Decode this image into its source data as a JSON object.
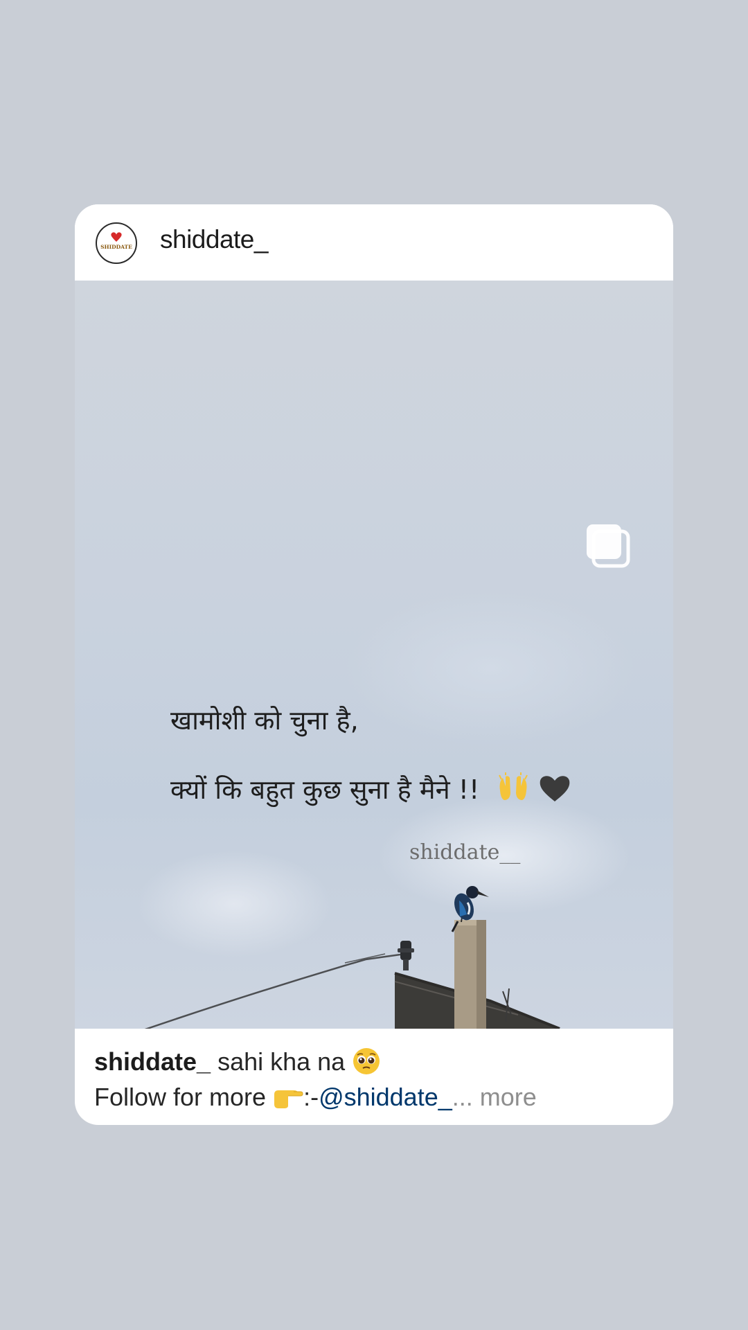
{
  "post": {
    "username": "shiddate_",
    "avatar_text": "SHIDDATE",
    "media": {
      "quote_line_1": "खामोशी को चुना है,",
      "quote_line_2": "क्यों कि बहुत कुछ सुना है मैने !!",
      "watermark": "shiddate__",
      "icons": [
        "raising-hands-emoji",
        "black-heart-emoji",
        "multiple-images-icon"
      ]
    },
    "caption": {
      "author": "shiddate_",
      "text": "sahi kha na",
      "line2_prefix": "Follow for more",
      "line2_sep": ":-",
      "mention": "@shiddate_",
      "ellipsis": "...",
      "more_label": "more"
    }
  },
  "colors": {
    "background": "#c9ced6",
    "card": "#ffffff",
    "mention": "#00376b",
    "muted": "#8e8e8e"
  }
}
